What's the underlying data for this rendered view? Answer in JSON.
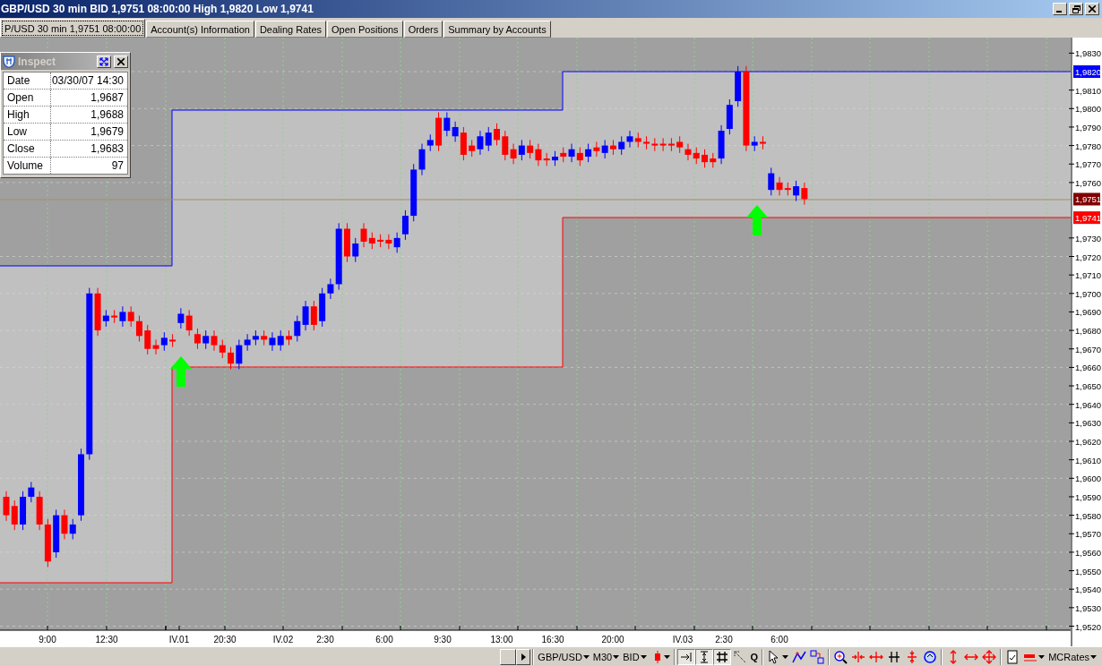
{
  "window": {
    "title": "GBP/USD 30 min BID 1,9751 08:00:00 High 1,9820 Low 1,9741"
  },
  "tabs": [
    {
      "label": "P/USD 30 min 1,9751 08:00:00",
      "selected": true
    },
    {
      "label": "Account(s) Information",
      "selected": false
    },
    {
      "label": "Dealing Rates",
      "selected": false
    },
    {
      "label": "Open Positions",
      "selected": false
    },
    {
      "label": "Orders",
      "selected": false
    },
    {
      "label": "Summary by Accounts",
      "selected": false
    }
  ],
  "inspect": {
    "title": "Inspect",
    "rows": [
      {
        "label": "Date",
        "value": "03/30/07 14:30"
      },
      {
        "label": "Open",
        "value": "1,9687"
      },
      {
        "label": "High",
        "value": "1,9688"
      },
      {
        "label": "Low",
        "value": "1,9679"
      },
      {
        "label": "Close",
        "value": "1,9683"
      },
      {
        "label": "Volume",
        "value": "97"
      }
    ]
  },
  "price_axis": [
    {
      "kind": "tick",
      "label": "1,9830"
    },
    {
      "kind": "marker",
      "label": "1,9820",
      "color": "#0000ff"
    },
    {
      "kind": "tick",
      "label": "1,9810"
    },
    {
      "kind": "tick",
      "label": "1,9800"
    },
    {
      "kind": "tick",
      "label": "1,9790"
    },
    {
      "kind": "tick",
      "label": "1,9780"
    },
    {
      "kind": "tick",
      "label": "1,9770"
    },
    {
      "kind": "tick",
      "label": "1,9760"
    },
    {
      "kind": "marker",
      "label": "1,9751",
      "color": "#800000"
    },
    {
      "kind": "marker",
      "label": "1,9741",
      "color": "#ff0000"
    },
    {
      "kind": "tick",
      "label": "1,9730"
    },
    {
      "kind": "tick",
      "label": "1,9720"
    },
    {
      "kind": "tick",
      "label": "1,9710"
    },
    {
      "kind": "tick",
      "label": "1,9700"
    },
    {
      "kind": "tick",
      "label": "1,9690"
    },
    {
      "kind": "tick",
      "label": "1,9680"
    },
    {
      "kind": "tick",
      "label": "1,9670"
    },
    {
      "kind": "tick",
      "label": "1,9660"
    },
    {
      "kind": "tick",
      "label": "1,9650"
    },
    {
      "kind": "tick",
      "label": "1,9640"
    },
    {
      "kind": "tick",
      "label": "1,9630"
    },
    {
      "kind": "tick",
      "label": "1,9620"
    },
    {
      "kind": "tick",
      "label": "1,9610"
    },
    {
      "kind": "tick",
      "label": "1,9600"
    },
    {
      "kind": "tick",
      "label": "1,9590"
    },
    {
      "kind": "tick",
      "label": "1,9580"
    },
    {
      "kind": "tick",
      "label": "1,9570"
    },
    {
      "kind": "tick",
      "label": "1,9560"
    },
    {
      "kind": "tick",
      "label": "1,9550"
    },
    {
      "kind": "tick",
      "label": "1,9540"
    },
    {
      "kind": "tick",
      "label": "1,9530"
    },
    {
      "kind": "tick",
      "label": "1,9520"
    }
  ],
  "time_axis": [
    "9:00",
    "12:30",
    "IV.01",
    "20:30",
    "IV.02",
    "2:30",
    "6:00",
    "9:30",
    "13:00",
    "16:30",
    "20:00",
    "IV.03",
    "2:30",
    "6:00"
  ],
  "toolbar": {
    "symbol": "GBP/USD",
    "timeframe": "M30",
    "price_type": "BID",
    "quote": "Q",
    "source": "MCRates"
  }
}
